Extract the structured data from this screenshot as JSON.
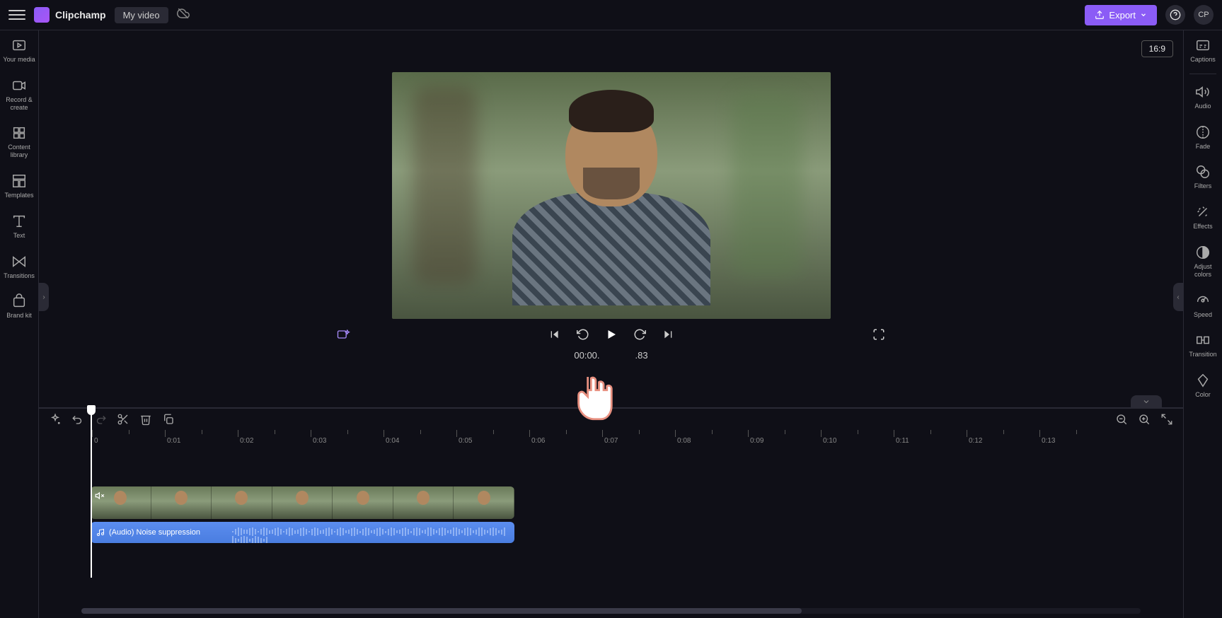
{
  "header": {
    "brand": "Clipchamp",
    "title": "My video",
    "export_label": "Export",
    "avatar_initials": "CP"
  },
  "left_rail": [
    {
      "id": "your-media",
      "label": "Your media"
    },
    {
      "id": "record-create",
      "label": "Record & create"
    },
    {
      "id": "content-library",
      "label": "Content library"
    },
    {
      "id": "templates",
      "label": "Templates"
    },
    {
      "id": "text",
      "label": "Text"
    },
    {
      "id": "transitions",
      "label": "Transitions"
    },
    {
      "id": "brand-kit",
      "label": "Brand kit"
    }
  ],
  "right_rail": [
    {
      "id": "captions",
      "label": "Captions"
    },
    {
      "id": "audio",
      "label": "Audio"
    },
    {
      "id": "fade",
      "label": "Fade"
    },
    {
      "id": "filters",
      "label": "Filters"
    },
    {
      "id": "effects",
      "label": "Effects"
    },
    {
      "id": "adjust-colors",
      "label": "Adjust colors"
    },
    {
      "id": "speed",
      "label": "Speed"
    },
    {
      "id": "transition",
      "label": "Transition"
    },
    {
      "id": "color",
      "label": "Color"
    }
  ],
  "preview": {
    "aspect_label": "16:9"
  },
  "playback": {
    "current_time": "00:00.",
    "duration_suffix": ".83"
  },
  "timeline": {
    "ticks": [
      "0",
      "0:01",
      "0:02",
      "0:03",
      "0:04",
      "0:05",
      "0:06",
      "0:07",
      "0:08",
      "0:09",
      "0:10",
      "0:11",
      "0:12",
      "0:13"
    ],
    "audio_clip_label": "(Audio) Noise suppression"
  }
}
